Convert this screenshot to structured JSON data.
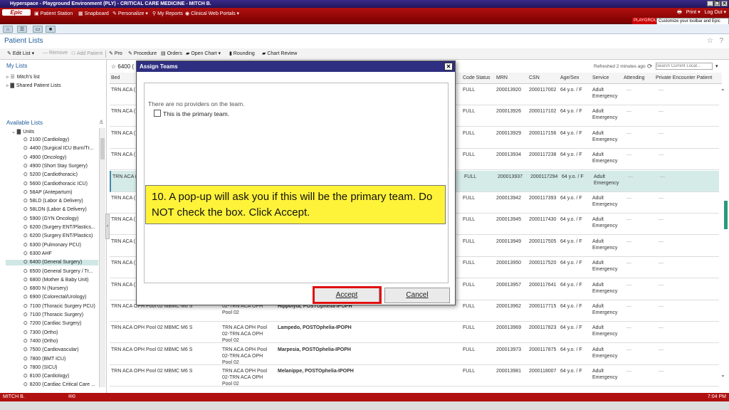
{
  "window": {
    "title": "Hyperspace - Playground Environment (PLY) - CRITICAL CARE MEDICINE - MITCH B."
  },
  "toolbar": {
    "epic_label": "Epic",
    "patient_station": "Patient Station",
    "snapboard": "Snapboard",
    "personalize": "Personalize",
    "my_reports": "My Reports",
    "clinical_web_portals": "Clinical Web Portals",
    "print": "Print",
    "log_out": "Log Out",
    "playground": "PLAYGROU",
    "customize_tip": "Customize your toolbar and Epic menu"
  },
  "page": {
    "title": "Patient Lists"
  },
  "actions": {
    "edit_list": "Edit List",
    "remove": "Remove",
    "add_patient": "Add Patient",
    "pro": "Pro",
    "procedure": "Procedure",
    "orders": "Orders",
    "open_chart": "Open Chart",
    "rounding": "Rounding",
    "chart_review": "Chart Review"
  },
  "sidebar": {
    "my_lists_heading": "My Lists",
    "mitchs_list": "Mitch's list",
    "shared_patient_lists": "Shared Patient Lists",
    "available_lists_heading": "Available Lists",
    "units_label": "Units",
    "units": [
      "2100 (Cardiology)",
      "4400 (Surgical ICU Burn/Tr...",
      "4900 (Oncology)",
      "4900 (Short Stay Surgery)",
      "5200 (Cardiothoracic)",
      "5600 (Cardiothoracic ICU)",
      "58AP (Antepartum)",
      "58LD (Labor & Delivery)",
      "58LDN (Labor & Delivery)",
      "5900 (GYN Oncology)",
      "6200 (Surgery ENT/Plastics...",
      "6200 (Surgery ENT/Plastics)",
      "6300 (Pulmonary PCU)",
      "6300 AHF",
      "6400 (General Surgery)",
      "6500 (General Surgery / Tr...",
      "6800 (Mother & Baby Unit)",
      "6800 N (Nursery)",
      "6900 (Colorectal/Urology)",
      "7100 (Thoracic Surgery PCU)",
      "7100 (Thoracic Surgery)",
      "7200 (Cardiac Surgery)",
      "7300 (Ortho)",
      "7400 (Ortho)",
      "7500 (Cardiovascular)",
      "7800 (BMT ICU)",
      "7800 (SICU)",
      "8100 (Cardiology)",
      "8200 (Cardiac Critical Care ..."
    ]
  },
  "grid": {
    "list_title": "6400 (",
    "refreshed": "Refreshed 2 minutes ago",
    "search_placeholder": "Search Current Locat...",
    "columns": {
      "bed": "Bed",
      "code_status": "Code Status",
      "mrn": "MRN",
      "csn": "CSN",
      "age_sex": "Age/Sex",
      "service": "Service",
      "attending": "Attending",
      "private_encounter": "Private Encounter Patient"
    },
    "rows": [
      {
        "bed": "TRN ACA (",
        "unit": "",
        "patient": "",
        "code": "FULL",
        "mrn": "200013920",
        "csn": "2000117002",
        "age": "64 y.o. / F",
        "service": "Adult Emergency"
      },
      {
        "bed": "TRN ACA (",
        "unit": "",
        "patient": "",
        "code": "FULL",
        "mrn": "200013926",
        "csn": "2000117102",
        "age": "64 y.o. / F",
        "service": "Adult Emergency"
      },
      {
        "bed": "TRN ACA (",
        "unit": "",
        "patient": "",
        "code": "FULL",
        "mrn": "200013929",
        "csn": "2000117156",
        "age": "64 y.o. / F",
        "service": "Adult Emergency"
      },
      {
        "bed": "TRN ACA (",
        "unit": "",
        "patient": "",
        "code": "FULL",
        "mrn": "200013934",
        "csn": "2000117238",
        "age": "64 y.o. / F",
        "service": "Adult Emergency"
      },
      {
        "bed": "TRN ACA (",
        "unit": "",
        "patient": "",
        "code": "FULL",
        "mrn": "200013937",
        "csn": "2000117294",
        "age": "64 y.o. / F",
        "service": "Adult Emergency"
      },
      {
        "bed": "TRN ACA (",
        "unit": "",
        "patient": "",
        "code": "FULL",
        "mrn": "200013942",
        "csn": "2000117393",
        "age": "64 y.o. / F",
        "service": "Adult Emergency"
      },
      {
        "bed": "TRN ACA (",
        "unit": "",
        "patient": "",
        "code": "FULL",
        "mrn": "200013945",
        "csn": "2000117430",
        "age": "64 y.o. / F",
        "service": "Adult Emergency"
      },
      {
        "bed": "TRN ACA (",
        "unit": "",
        "patient": "",
        "code": "FULL",
        "mrn": "200013949",
        "csn": "2000117505",
        "age": "64 y.o. / F",
        "service": "Adult Emergency"
      },
      {
        "bed": "TRN ACA (",
        "unit": "",
        "patient": "",
        "code": "FULL",
        "mrn": "200013950",
        "csn": "2000117520",
        "age": "64 y.o. / F",
        "service": "Adult Emergency"
      },
      {
        "bed": "TRN ACA (",
        "unit": "",
        "patient": "",
        "code": "FULL",
        "mrn": "200013957",
        "csn": "2000117641",
        "age": "64 y.o. / F",
        "service": "Adult Emergency"
      },
      {
        "bed": "TRN ACA OPH Pool 02  MBMC M6 S",
        "unit": "02-TRN ACA OPH Pool 02",
        "patient": "Hippolyta, POSTOphelia-IPOPH",
        "code": "FULL",
        "mrn": "200013962",
        "csn": "2000117715",
        "age": "64 y.o. / F",
        "service": "Adult Emergency"
      },
      {
        "bed": "TRN ACA OPH Pool 02  MBMC M6 S",
        "unit": "TRN ACA OPH Pool 02-TRN ACA OPH Pool 02",
        "patient": "Lampedo, POSTOphelia-IPOPH",
        "code": "FULL",
        "mrn": "200013969",
        "csn": "2000117823",
        "age": "64 y.o. / F",
        "service": "Adult Emergency"
      },
      {
        "bed": "TRN ACA OPH Pool 02  MBMC M6 S",
        "unit": "TRN ACA OPH Pool 02-TRN ACA OPH Pool 02",
        "patient": "Marpesia, POSTOphelia-IPOPH",
        "code": "FULL",
        "mrn": "200013973",
        "csn": "2000117875",
        "age": "64 y.o. / F",
        "service": "Adult Emergency"
      },
      {
        "bed": "TRN ACA OPH Pool 02  MBMC M6 S",
        "unit": "TRN ACA OPH Pool 02-TRN ACA OPH Pool 02",
        "patient": "Melanippe, POSTOphelia-IPOPH",
        "code": "FULL",
        "mrn": "200013981",
        "csn": "2000118007",
        "age": "64 y.o. / F",
        "service": "Adult Emergency"
      }
    ]
  },
  "dialog": {
    "title": "Assign Teams",
    "message": "There are no providers on the team.",
    "checkbox_label": "This is the primary team.",
    "accept": "Accept",
    "cancel": "Cancel"
  },
  "callout": {
    "text": "10. A pop-up will ask you if this will be the primary team.  Do NOT check the box.  Click Accept."
  },
  "status": {
    "user": "MITCH B.",
    "messages": "0",
    "time": "7:04 PM"
  },
  "colors": {
    "epic_red": "#b01010",
    "title_blue": "#1f5c99",
    "highlight_red": "#e01010",
    "callout_yellow": "#fff33a"
  }
}
